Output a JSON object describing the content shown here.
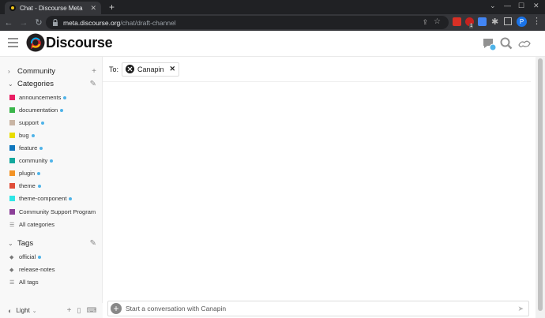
{
  "browser": {
    "tab_title": "Chat - Discourse Meta",
    "new_tab": "+",
    "url_host": "meta.discourse.org",
    "url_path": "/chat/draft-channel",
    "profile_initial": "P",
    "ext_badge": "1"
  },
  "header": {
    "logo_text": "Discourse"
  },
  "sidebar": {
    "community_label": "Community",
    "categories_label": "Categories",
    "categories": [
      {
        "label": "announcements",
        "color": "#e45735",
        "color2": "#e91e63",
        "new": true
      },
      {
        "label": "documentation",
        "color": "#3ab54a",
        "new": true
      },
      {
        "label": "support",
        "color": "#c9b5a4",
        "new": true
      },
      {
        "label": "bug",
        "color": "#e9dd00",
        "new": true
      },
      {
        "label": "feature",
        "color": "#0e76bd",
        "new": true
      },
      {
        "label": "community",
        "color": "#12a89d",
        "new": true
      },
      {
        "label": "plugin",
        "color": "#f39325",
        "new": true
      },
      {
        "label": "theme",
        "color": "#e04e39",
        "new": true
      },
      {
        "label": "theme-component",
        "color": "#2ee6e6",
        "new": true
      },
      {
        "label": "Community Support Program",
        "color": "#8c3f98",
        "new": false
      }
    ],
    "all_categories": "All categories",
    "tags_label": "Tags",
    "tags": [
      {
        "label": "official",
        "new": true
      },
      {
        "label": "release-notes",
        "new": false
      }
    ],
    "all_tags": "All tags",
    "theme_select": "Light"
  },
  "main": {
    "to_label": "To:",
    "recipient": "Canapin",
    "composer_placeholder": "Start a conversation with Canapin"
  }
}
